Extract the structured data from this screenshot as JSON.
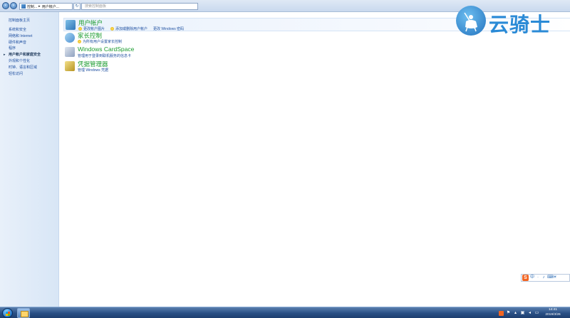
{
  "address_bar": {
    "breadcrumbs": [
      "控制...",
      "用户帐户..."
    ],
    "search_placeholder": "搜索控制面板"
  },
  "left_nav": {
    "home": "控制面板主页",
    "items": [
      {
        "label": "系统和安全",
        "current": false
      },
      {
        "label": "网络和 Internet",
        "current": false
      },
      {
        "label": "硬件和声音",
        "current": false
      },
      {
        "label": "程序",
        "current": false
      },
      {
        "label": "用户帐户和家庭安全",
        "current": true
      },
      {
        "label": "外观和个性化",
        "current": false
      },
      {
        "label": "时钟、语言和区域",
        "current": false
      },
      {
        "label": "轻松访问",
        "current": false
      }
    ]
  },
  "categories": [
    {
      "title": "用户帐户",
      "links": [
        "更改帐户图片",
        "添加或删除用户帐户",
        "更改 Windows 密码"
      ],
      "icon": "users-icon"
    },
    {
      "title": "家长控制",
      "links": [
        "为所有用户设置家长控制"
      ],
      "icon": "parental-control-icon"
    },
    {
      "title": "Windows CardSpace",
      "links": [
        "管理用于登录到联机服务的信息卡"
      ],
      "icon": "cardspace-icon"
    },
    {
      "title": "凭据管理器",
      "links": [
        "管理 Windows 凭据"
      ],
      "icon": "credential-manager-icon"
    }
  ],
  "watermark": {
    "text": "云骑士"
  },
  "ime": {
    "brand": "S",
    "items": [
      "中",
      "·",
      "♪",
      "⌨",
      "☀"
    ]
  },
  "taskbar": {
    "time": "14:41",
    "date": "2019/3/26"
  },
  "colors": {
    "link_blue": "#1e4fa0",
    "category_green": "#1a9b2e",
    "nav_bg": "#e8f0fa",
    "taskbar": "#294f85",
    "logo_blue": "#2a8ad6"
  }
}
